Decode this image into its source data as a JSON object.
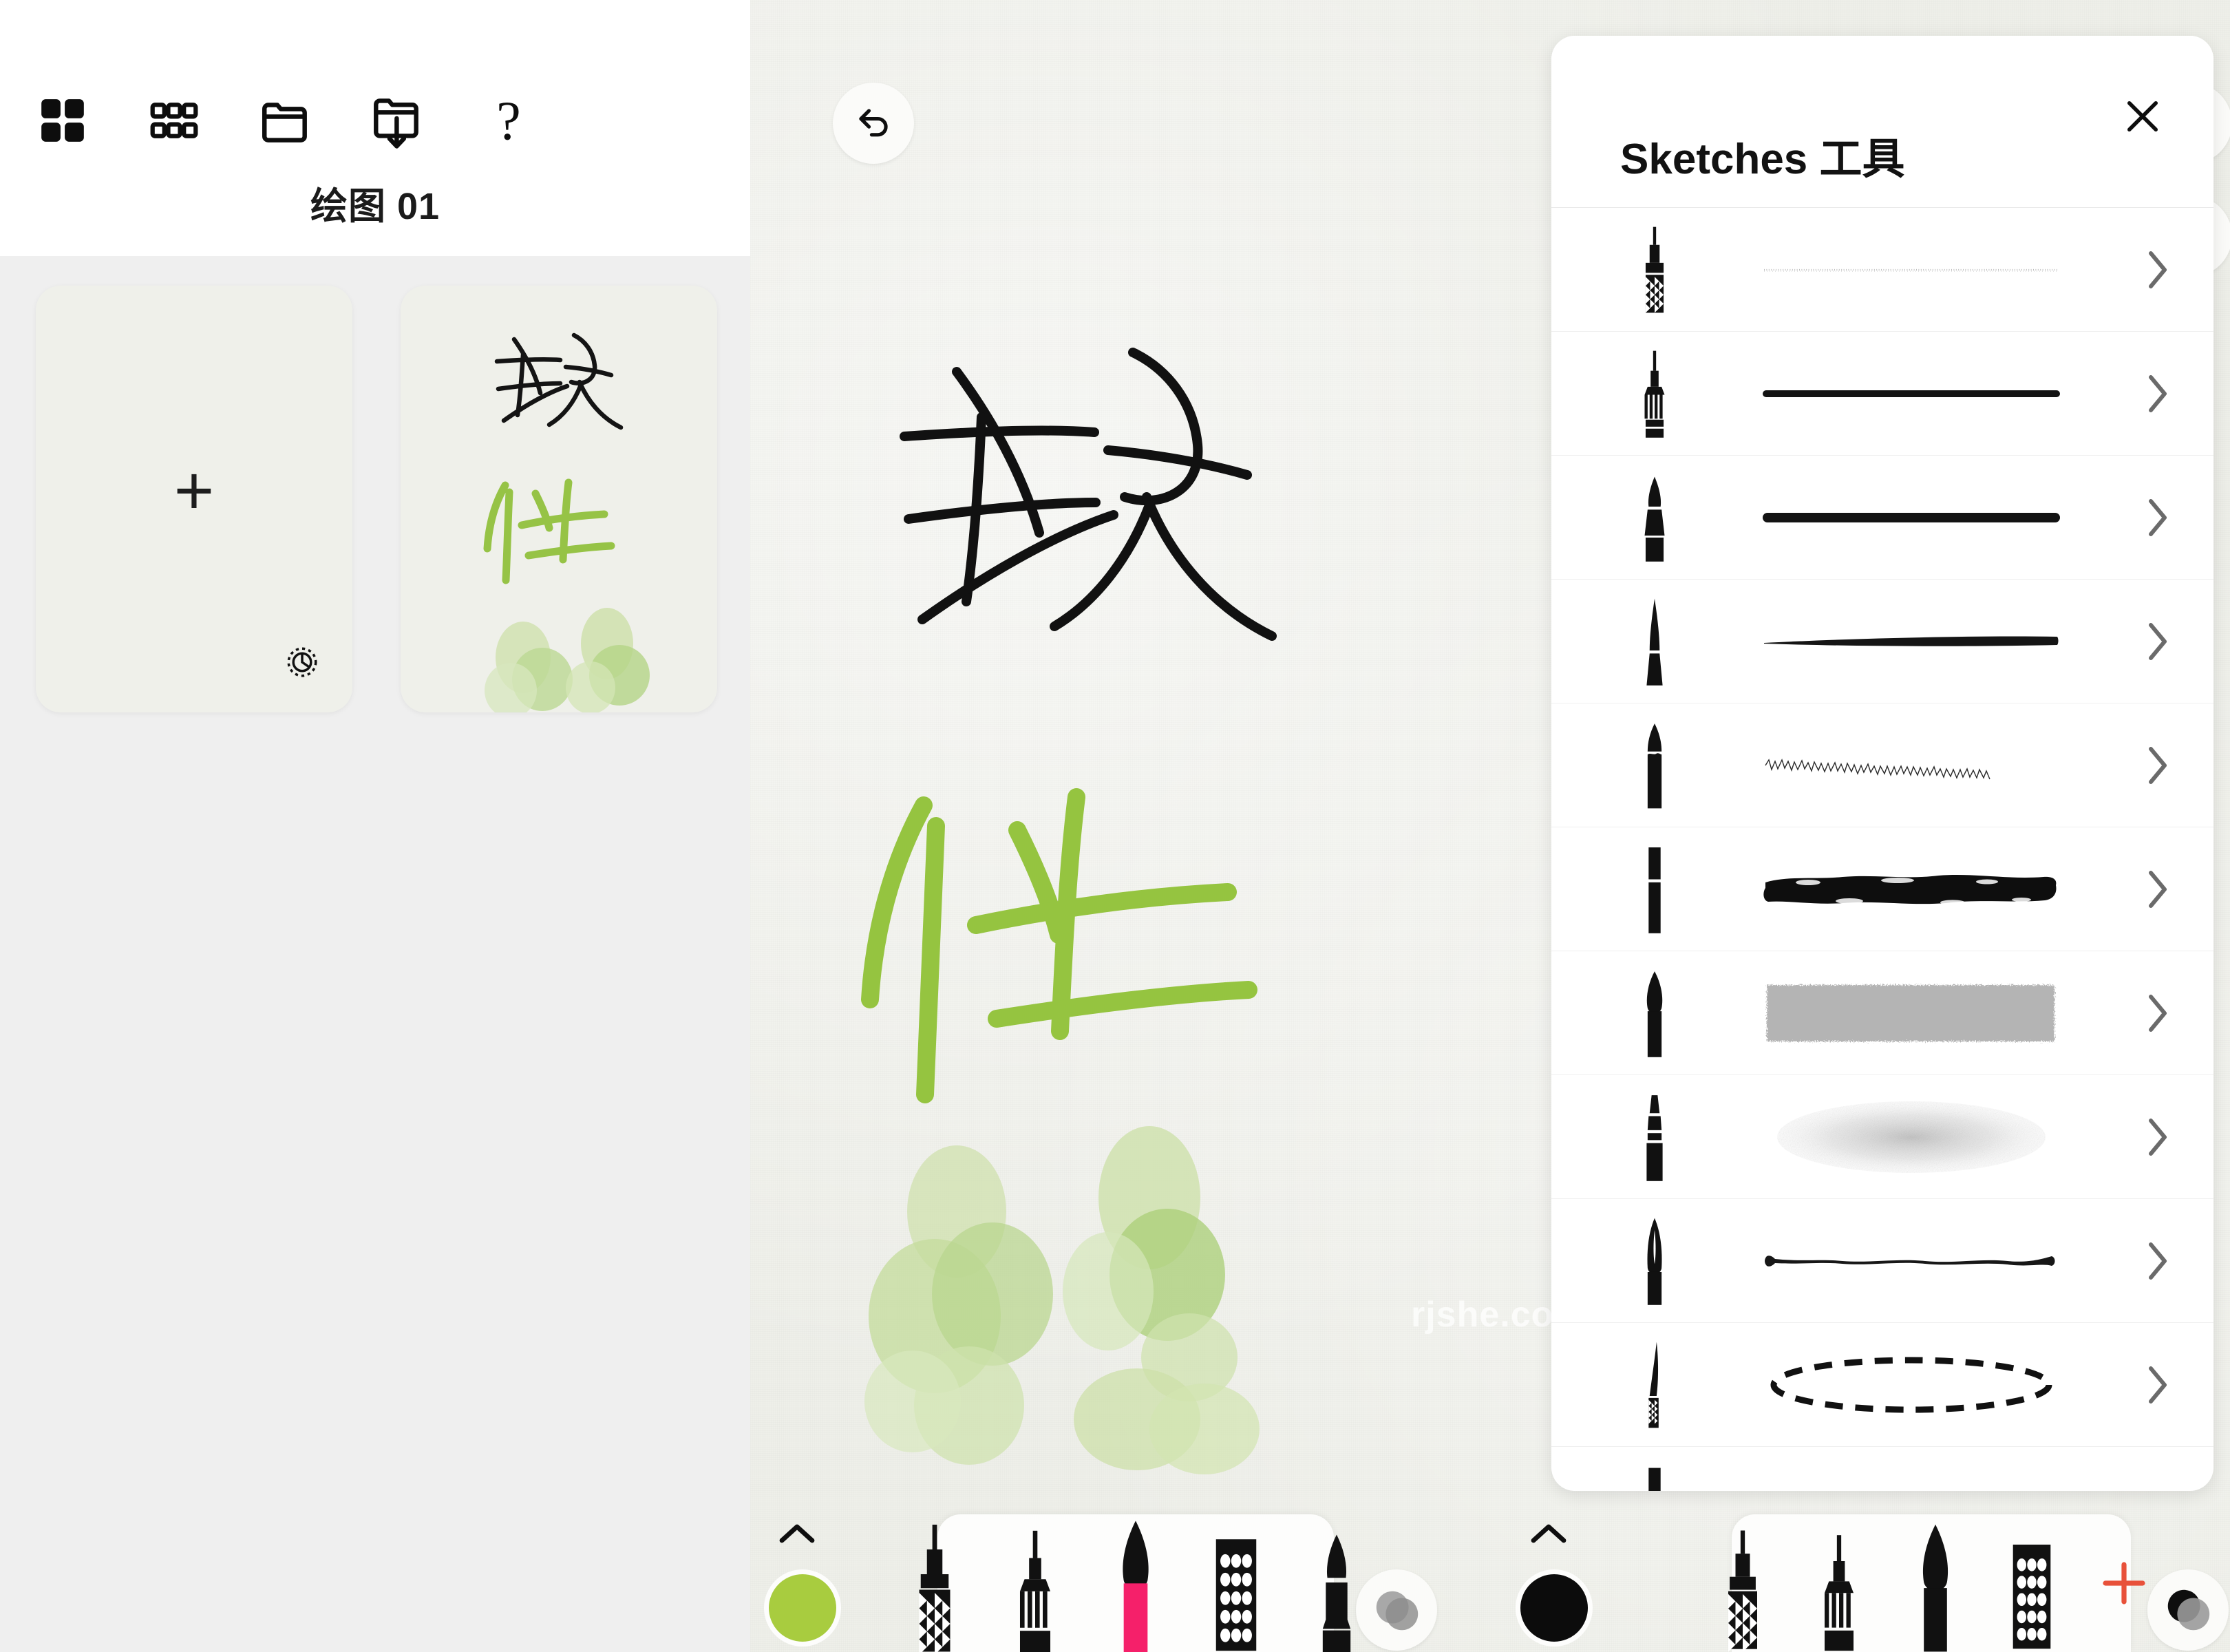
{
  "app": {
    "canvas_bg": "#eeefe9",
    "accent_green": "#a8cc3f",
    "accent_pink": "#f5206a",
    "accent_red": "#e8513a"
  },
  "gallery": {
    "title": "绘图 01",
    "toolbar": [
      {
        "name": "grid-4-icon",
        "label": "Grid view"
      },
      {
        "name": "grid-9-icon",
        "label": "Small grid view"
      },
      {
        "name": "folder-icon",
        "label": "Folder"
      },
      {
        "name": "folder-import-icon",
        "label": "Import folder"
      },
      {
        "name": "help-icon",
        "label": "?"
      }
    ],
    "thumbnails": [
      {
        "kind": "new",
        "plus": "+",
        "gear": "settings-gear-icon"
      },
      {
        "kind": "artwork",
        "strokes_black": "软",
        "strokes_green": "件"
      }
    ]
  },
  "canvas": {
    "watermark": "rjshe.com",
    "artwork": {
      "char_black": "软",
      "char_green": "件"
    },
    "top_buttons": [
      {
        "name": "undo-button",
        "icon": "undo-icon"
      },
      {
        "name": "more-button",
        "icon": "ellipsis-icon"
      },
      {
        "name": "grid-button",
        "icon": "grid-4-icon"
      },
      {
        "name": "layers-button",
        "icon": "layers-icon"
      },
      {
        "name": "adjustments-button",
        "icon": "sliders-icon"
      }
    ]
  },
  "left_dock": {
    "collapse_label": "^",
    "color_swatch": "#a8cc3f",
    "opacity_icon": "opacity-circles-icon",
    "tools": [
      {
        "name": "tool-pencil",
        "highlight": ""
      },
      {
        "name": "tool-marker",
        "highlight": ""
      },
      {
        "name": "tool-brush",
        "highlight": "#f5206a"
      },
      {
        "name": "tool-eraser",
        "highlight": ""
      },
      {
        "name": "tool-highlighter",
        "highlight": ""
      }
    ]
  },
  "right_dock": {
    "collapse_label": "^",
    "color_swatch": "#0c0c0c",
    "add_label": "+",
    "add_color": "#e8513a",
    "opacity_icon": "opacity-circles-icon",
    "tools": [
      {
        "name": "tool-pencil"
      },
      {
        "name": "tool-marker"
      },
      {
        "name": "tool-brush"
      },
      {
        "name": "tool-eraser"
      }
    ]
  },
  "tool_panel": {
    "title": "Sketches 工具",
    "close_label": "close-icon",
    "brushes": [
      {
        "name": "brush-textured-pencil",
        "icon": "pencil-crosshatch-icon",
        "preview": "faint-dotted-line",
        "chevron": ">"
      },
      {
        "name": "brush-fine-liner",
        "icon": "pen-fine-icon",
        "preview": "solid-thin-bar",
        "chevron": ">"
      },
      {
        "name": "brush-marker",
        "icon": "marker-icon",
        "preview": "solid-thick-bar",
        "chevron": ">"
      },
      {
        "name": "brush-ink-pen",
        "icon": "nib-taper-icon",
        "preview": "tapered-stroke",
        "chevron": ">"
      },
      {
        "name": "brush-dry-brush",
        "icon": "chisel-icon",
        "preview": "rough-dry-stroke",
        "chevron": ">"
      },
      {
        "name": "brush-heavy-paint",
        "icon": "flat-brush-icon",
        "preview": "heavy-paint-stroke",
        "chevron": ">"
      },
      {
        "name": "brush-watercolor",
        "icon": "round-brush-icon",
        "preview": "grey-wash-block",
        "chevron": ">"
      },
      {
        "name": "brush-airbrush",
        "icon": "airbrush-icon",
        "preview": "soft-spray-cloud",
        "chevron": ">"
      },
      {
        "name": "brush-calligraphy-nib",
        "icon": "fountain-nib-icon",
        "preview": "nib-taper-line",
        "chevron": ">"
      },
      {
        "name": "brush-selection",
        "icon": "knife-crosshatch-icon",
        "preview": "dashed-ellipse",
        "chevron": ">"
      }
    ]
  }
}
